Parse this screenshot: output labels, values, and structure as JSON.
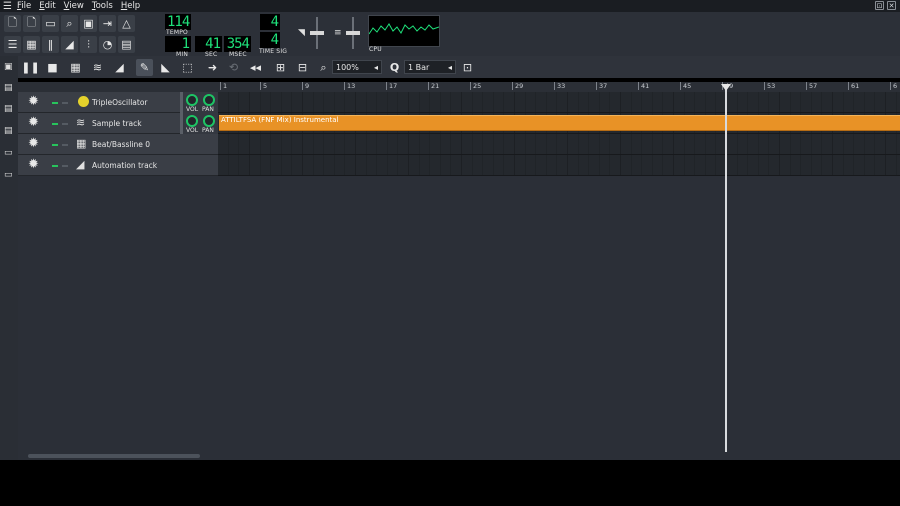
{
  "menu": [
    "File",
    "Edit",
    "View",
    "Tools",
    "Help"
  ],
  "window_buttons": [
    "⊡",
    "✕"
  ],
  "transport": {
    "tempo": "114",
    "tempo_label": "TEMPO",
    "min": "1",
    "sec": "41",
    "msec": "354",
    "min_label": "MIN",
    "sec_label": "SEC",
    "msec_label": "MSEC",
    "timesig_top": "4",
    "timesig_bottom": "4",
    "timesig_label": "TIME SIG",
    "cpu_label": "CPU"
  },
  "edit_toolbar": {
    "zoom": "100%",
    "quantize": "1 Bar"
  },
  "ruler": [
    "1",
    "5",
    "9",
    "13",
    "17",
    "21",
    "25",
    "29",
    "33",
    "37",
    "41",
    "45",
    "49",
    "53",
    "57",
    "61",
    "6"
  ],
  "knob_labels": {
    "vol": "VOL",
    "pan": "PAN"
  },
  "tracks": [
    {
      "name": "TripleOscillator",
      "icon": "triple-oscillator-icon",
      "has_knobs": true
    },
    {
      "name": "Sample track",
      "icon": "waveform-icon",
      "has_knobs": true
    },
    {
      "name": "Beat/Bassline 0",
      "icon": "beat-grid-icon",
      "has_knobs": false
    },
    {
      "name": "Automation track",
      "icon": "automation-ramp-icon",
      "has_knobs": false
    }
  ],
  "clip": {
    "label": "ATTILTFSA (FNF Mix) Instrumental"
  },
  "colors": {
    "accent": "#e89226",
    "lcd": "#1ee07a",
    "knob": "#1ec465"
  }
}
